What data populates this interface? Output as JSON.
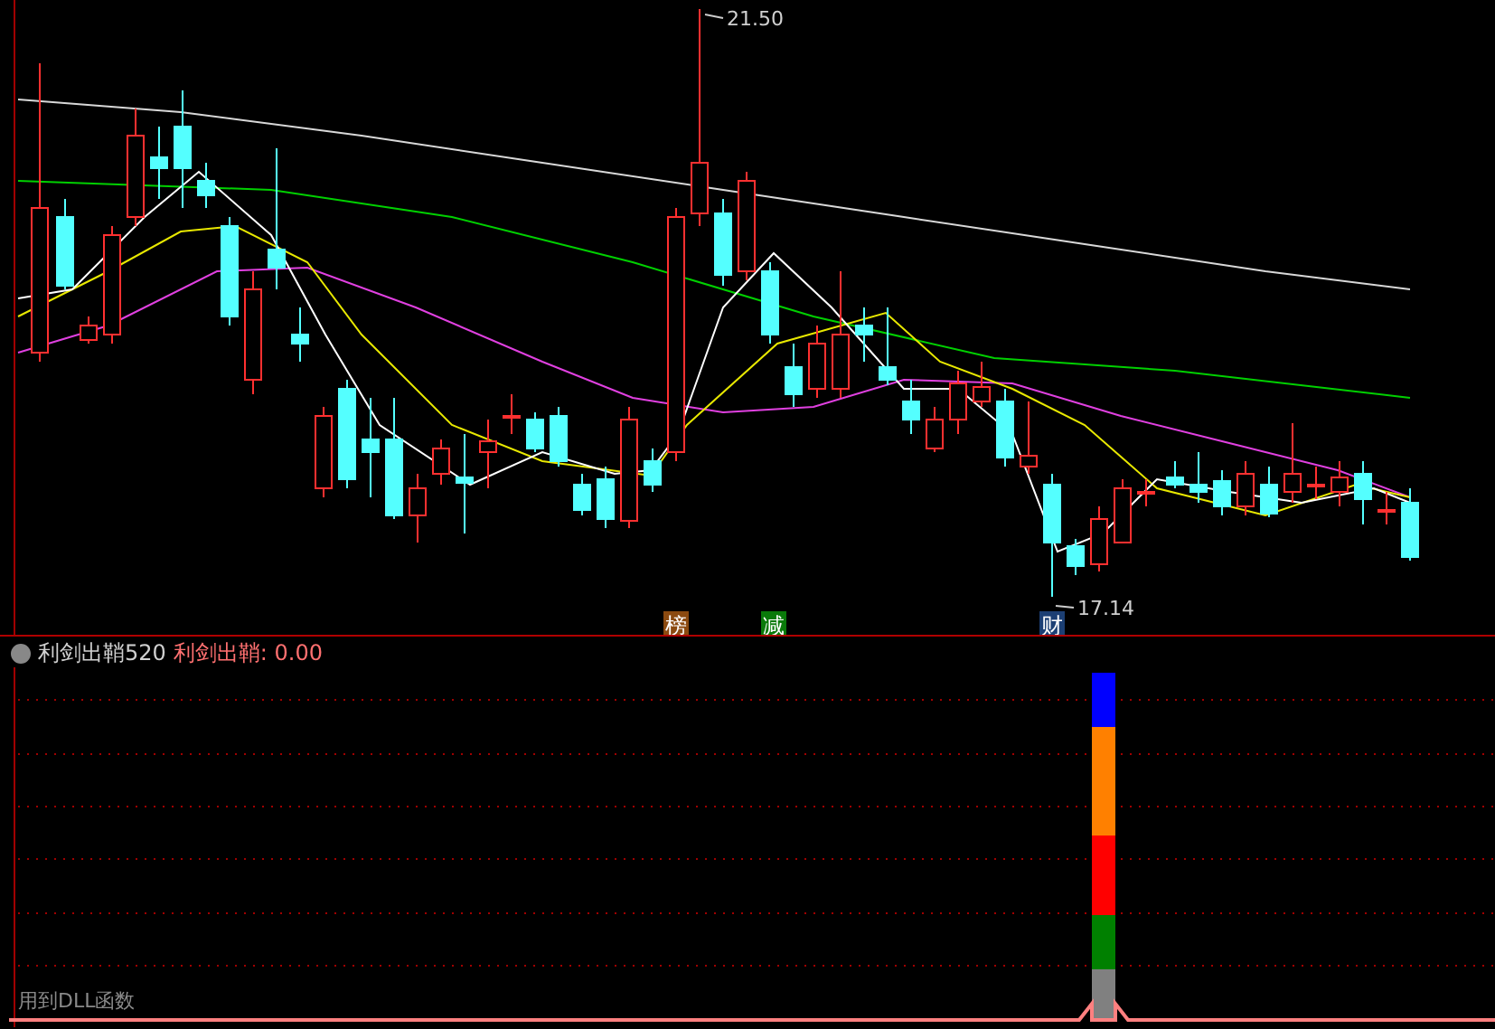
{
  "main_chart": {
    "high_label": "21.50",
    "low_label": "17.14",
    "markers": [
      {
        "text": "榜",
        "color": "#8b4a10"
      },
      {
        "text": "减",
        "color": "#0a7a0a"
      },
      {
        "text": "财",
        "color": "#1c3f74"
      }
    ]
  },
  "indicator_panel": {
    "name": "利剑出鞘520",
    "value_label": "利剑出鞘:",
    "value": "0.00",
    "stack_segments": [
      {
        "color": "#0000ff"
      },
      {
        "color": "#ff8000"
      },
      {
        "color": "#ff0000"
      },
      {
        "color": "#008000"
      },
      {
        "color": "#808080"
      }
    ]
  },
  "footer_text": "用到DLL函数"
}
